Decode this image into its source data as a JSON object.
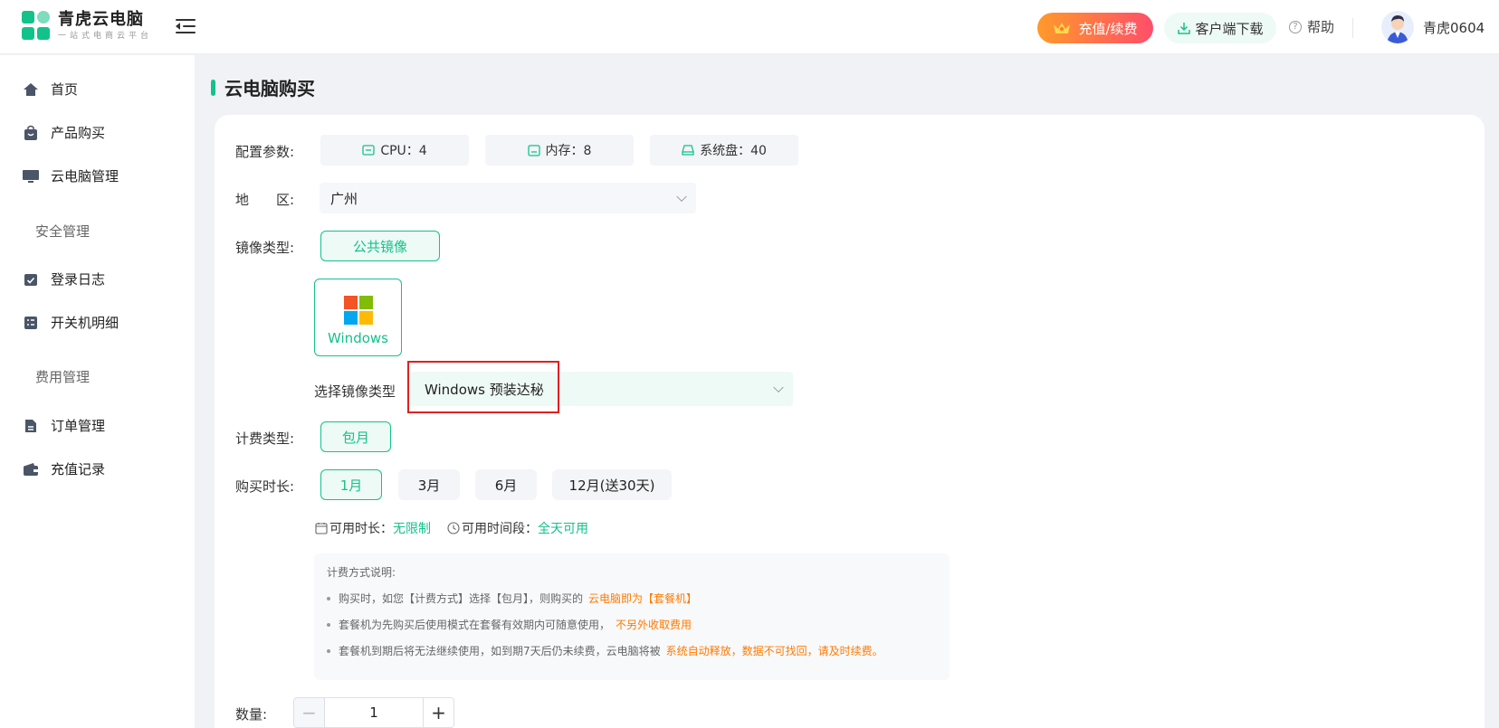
{
  "header": {
    "brand_name": "青虎云电脑",
    "brand_tagline": "一站式电商云平台",
    "recharge_label": "充值/续费",
    "download_label": "客户端下载",
    "help_label": "帮助",
    "username": "青虎0604"
  },
  "sidebar": {
    "items": [
      {
        "label": "首页"
      },
      {
        "label": "产品购买"
      },
      {
        "label": "云电脑管理"
      },
      {
        "label": "安全管理"
      },
      {
        "label": "登录日志"
      },
      {
        "label": "开关机明细"
      },
      {
        "label": "费用管理"
      },
      {
        "label": "订单管理"
      },
      {
        "label": "充值记录"
      }
    ]
  },
  "main": {
    "page_title": "云电脑购买",
    "config": {
      "label": "配置参数:",
      "cpu": "CPU：4",
      "memory": "内存：8",
      "disk": "系统盘：40"
    },
    "region": {
      "label": "地　　区:",
      "value": "广州"
    },
    "image_type": {
      "label": "镜像类型:",
      "option": "公共镜像"
    },
    "os": {
      "name": "Windows"
    },
    "image_select": {
      "label": "选择镜像类型",
      "value": "Windows 预装达秘"
    },
    "billing": {
      "label": "计费类型:",
      "option": "包月"
    },
    "duration": {
      "label": "购买时长:",
      "options": [
        "1月",
        "3月",
        "6月",
        "12月(送30天)"
      ],
      "selected": "1月"
    },
    "availability": {
      "duration_label": "可用时长：",
      "duration_value": "无限制",
      "period_label": "可用时间段：",
      "period_value": "全天可用"
    },
    "note": {
      "title": "计费方式说明:",
      "lines": [
        {
          "text": "购买时，如您【计费方式】选择【包月】，则购买的",
          "highlight": "云电脑即为【套餐机】"
        },
        {
          "text": "套餐机为先购买后使用模式在套餐有效期内可随意使用，",
          "highlight": "不另外收取费用"
        },
        {
          "text": "套餐机到期后将无法继续使用，如到期7天后仍未续费，云电脑将被",
          "highlight": "系统自动释放，数据不可找回，请及时续费。"
        }
      ]
    },
    "quantity": {
      "label": "数量:",
      "value": "1"
    }
  },
  "colors": {
    "accent": "#13c28a",
    "warning": "#ff7a00",
    "highlight_border": "#e02020"
  }
}
